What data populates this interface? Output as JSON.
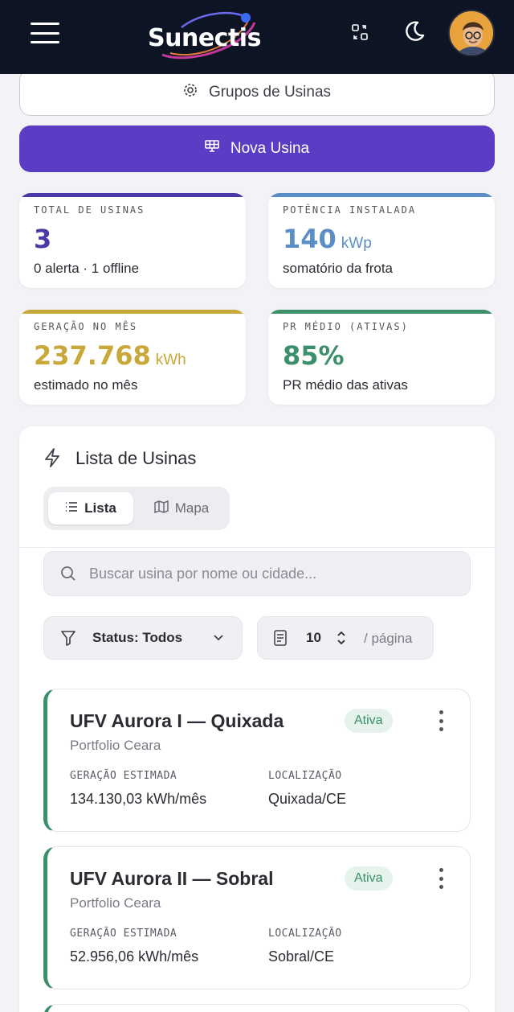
{
  "header": {
    "brand": "Sunectis",
    "menu_icon": "hamburger-icon",
    "switch_icon": "swap-icon",
    "theme_icon": "moon-icon",
    "avatar_icon": "user-avatar"
  },
  "actions": {
    "groups_label": "Grupos de Usinas",
    "groups_icon": "gear-icon",
    "new_label": "Nova Usina",
    "new_icon": "solar-panel-icon"
  },
  "stats": [
    {
      "label": "TOTAL DE USINAS",
      "value": "3",
      "unit": "",
      "sub": "0 alerta · 1 offline",
      "color": "#4a3aa8"
    },
    {
      "label": "POTÊNCIA INSTALADA",
      "value": "140",
      "unit": "kWp",
      "sub": "somatório da frota",
      "color": "#5b8ec7"
    },
    {
      "label": "GERAÇÃO NO MÊS",
      "value": "237.768",
      "unit": "kWh",
      "sub": "estimado no mês",
      "color": "#c9a83a"
    },
    {
      "label": "PR MÉDIO (ATIVAS)",
      "value": "85%",
      "unit": "",
      "sub": "PR médio das ativas",
      "color": "#3b8f6a"
    }
  ],
  "list": {
    "title": "Lista de Usinas",
    "title_icon": "bolt-icon",
    "tab_list": "Lista",
    "tab_map": "Mapa",
    "search_placeholder": "Buscar usina por nome ou cidade...",
    "filter_label": "Status: Todos",
    "page_size": "10",
    "page_suffix": "/ página"
  },
  "plants": [
    {
      "name": "UFV Aurora I — Quixada",
      "portfolio": "Portfolio Ceara",
      "status": "Ativa",
      "gen_label": "GERAÇÃO ESTIMADA",
      "gen_value": "134.130,03 kWh/mês",
      "loc_label": "LOCALIZAÇÃO",
      "loc_value": "Quixada/CE"
    },
    {
      "name": "UFV Aurora II — Sobral",
      "portfolio": "Portfolio Ceara",
      "status": "Ativa",
      "gen_label": "GERAÇÃO ESTIMADA",
      "gen_value": "52.956,06 kWh/mês",
      "loc_label": "LOCALIZAÇÃO",
      "loc_value": "Sobral/CE"
    }
  ],
  "colors": {
    "primary": "#5b3cc4",
    "topbar": "#0d1424",
    "active_green": "#3b8f6a"
  }
}
